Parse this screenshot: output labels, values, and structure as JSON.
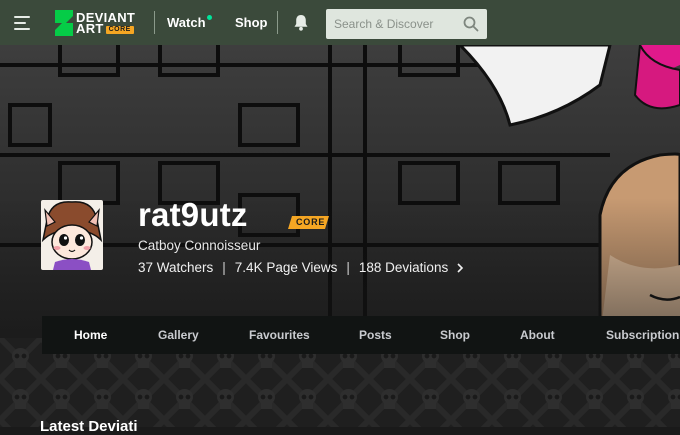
{
  "header": {
    "logo_text_line1": "DEVIANT",
    "logo_text_line2": "ART",
    "logo_badge": "CORE",
    "nav": [
      {
        "label": "Watch"
      },
      {
        "label": "Shop"
      }
    ],
    "search_placeholder": "Search & Discover",
    "icons": [
      "menu-icon",
      "deviantart-logo-icon",
      "bell-icon",
      "search-icon"
    ],
    "colors": {
      "bar": "#3b4a3b",
      "watch_dot": "#00e59b",
      "core_badge": "#f5a623"
    }
  },
  "profile": {
    "username": "rat9utz",
    "badge": "CORE",
    "tagline": "Catboy Connoisseur",
    "stats": {
      "watchers": "37 Watchers",
      "page_views": "7.4K Page Views",
      "deviations": "188 Deviations"
    }
  },
  "tabs": [
    {
      "label": "Home",
      "active": true
    },
    {
      "label": "Gallery"
    },
    {
      "label": "Favourites"
    },
    {
      "label": "Posts"
    },
    {
      "label": "Shop"
    },
    {
      "label": "About"
    },
    {
      "label": "Subscriptions"
    }
  ],
  "section": {
    "title": "Latest Deviati"
  }
}
